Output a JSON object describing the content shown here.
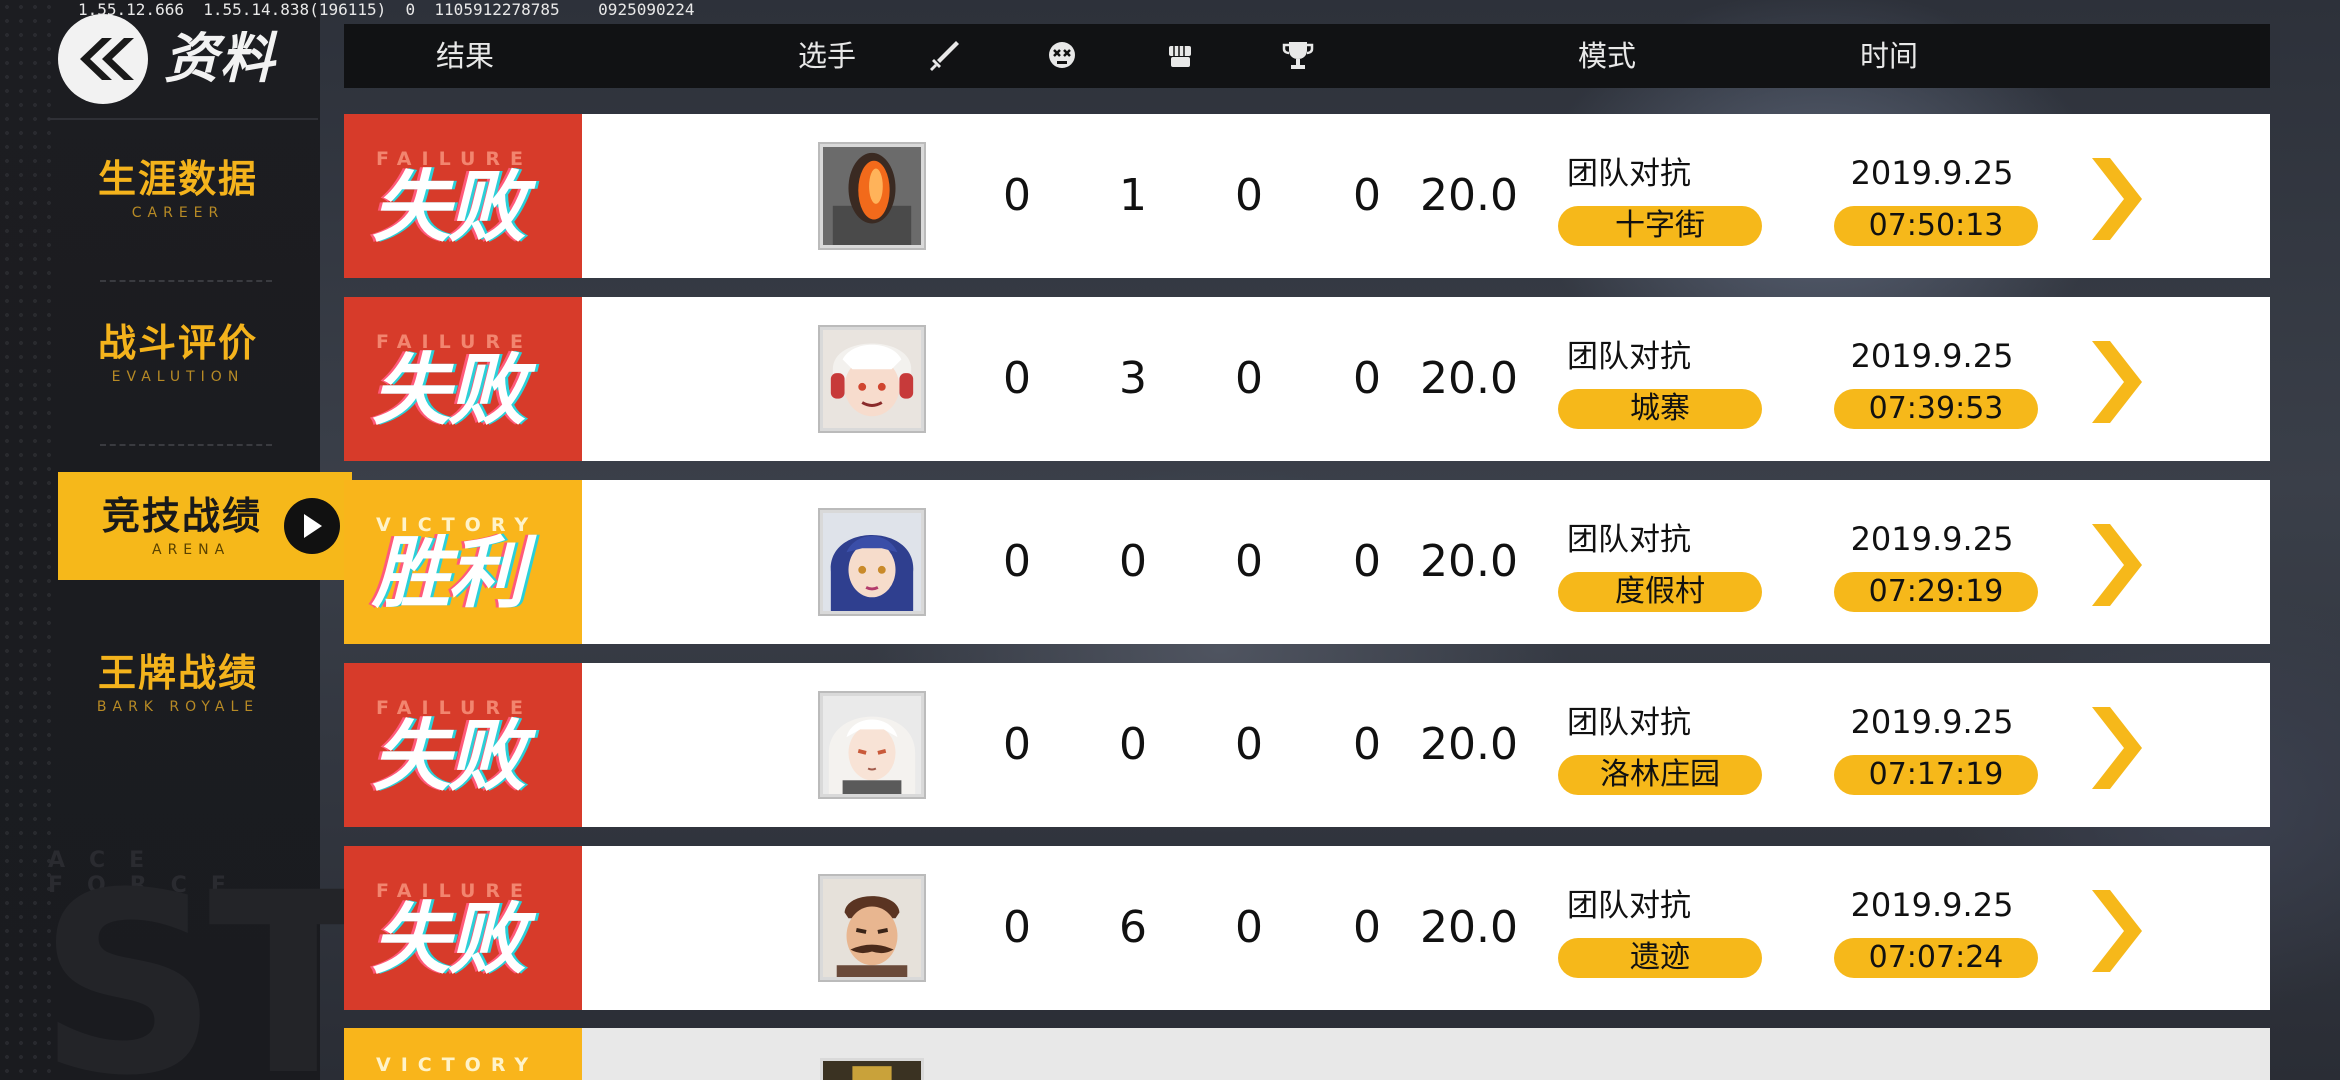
{
  "debug_info": "1.55.12.666  1.55.14.838(196115)  0  1105912278785    0925090224",
  "header_title": "资料",
  "sidebar": {
    "items": [
      {
        "cn": "生涯数据",
        "en": "CAREER"
      },
      {
        "cn": "战斗评价",
        "en": "EVALUTION"
      },
      {
        "cn": "竞技战绩",
        "en": "ARENA"
      },
      {
        "cn": "王牌战绩",
        "en": "BARK ROYALE"
      }
    ],
    "active_index": 2,
    "watermark_small": "ACE FORCE",
    "watermark_big": "ST"
  },
  "table": {
    "headers": {
      "result": "结果",
      "player": "选手",
      "kills_icon": "sword-icon",
      "deaths_icon": "skull-icon",
      "assists_icon": "fist-icon",
      "mvp_icon": "trophy-icon",
      "mode": "模式",
      "time": "时间"
    },
    "rows": [
      {
        "result": "failure",
        "result_en": "FAILURE",
        "result_cn": "失败",
        "avatar": "robot-avatar",
        "kills": "0",
        "deaths": "1",
        "assists": "0",
        "mvp": "0",
        "score": "20.0",
        "mode": "团队对抗",
        "map": "十字街",
        "date": "2019.9.25",
        "time": "07:50:13"
      },
      {
        "result": "failure",
        "result_en": "FAILURE",
        "result_cn": "失败",
        "avatar": "white-hair-headphones-avatar",
        "kills": "0",
        "deaths": "3",
        "assists": "0",
        "mvp": "0",
        "score": "20.0",
        "mode": "团队对抗",
        "map": "城寨",
        "date": "2019.9.25",
        "time": "07:39:53"
      },
      {
        "result": "victory",
        "result_en": "VICTORY",
        "result_cn": "胜利",
        "avatar": "blue-hair-avatar",
        "kills": "0",
        "deaths": "0",
        "assists": "0",
        "mvp": "0",
        "score": "20.0",
        "mode": "团队对抗",
        "map": "度假村",
        "date": "2019.9.25",
        "time": "07:29:19"
      },
      {
        "result": "failure",
        "result_en": "FAILURE",
        "result_cn": "失败",
        "avatar": "white-hair-avatar",
        "kills": "0",
        "deaths": "0",
        "assists": "0",
        "mvp": "0",
        "score": "20.0",
        "mode": "团队对抗",
        "map": "洛林庄园",
        "date": "2019.9.25",
        "time": "07:17:19"
      },
      {
        "result": "failure",
        "result_en": "FAILURE",
        "result_cn": "失败",
        "avatar": "mustache-man-avatar",
        "kills": "0",
        "deaths": "6",
        "assists": "0",
        "mvp": "0",
        "score": "20.0",
        "mode": "团队对抗",
        "map": "遗迹",
        "date": "2019.9.25",
        "time": "07:07:24"
      }
    ],
    "partial_row": {
      "result": "victory",
      "result_en": "VICTORY"
    }
  },
  "colors": {
    "accent_yellow": "#f6b81a",
    "failure_red": "#d73b2a",
    "victory_yellow": "#f9b51b",
    "sidebar_bg": "#1c1d21",
    "header_bg": "#111214"
  }
}
